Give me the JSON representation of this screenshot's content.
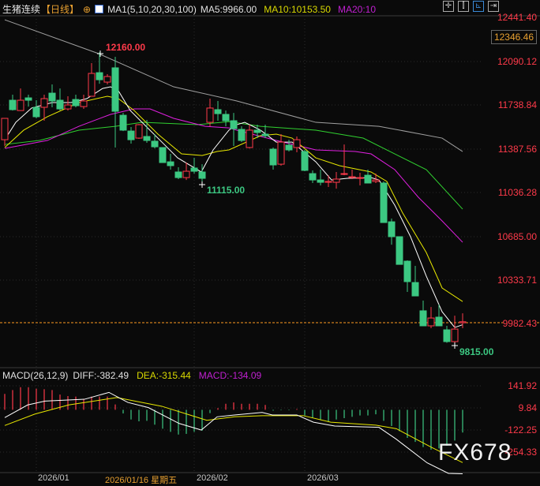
{
  "header": {
    "symbol": "生猪连续",
    "period": "【日线】",
    "indicator": "MA1(5,10,20,30,100)",
    "ma5": "MA5:9966.00",
    "ma10": "MA10:10153.50",
    "ma20": "MA20:10"
  },
  "macd_header": {
    "name": "MACD(26,12,9)",
    "diff": "DIFF:-382.49",
    "dea": "DEA:-315.44",
    "macd": "MACD:-134.09"
  },
  "price_axis": [
    "12441.40",
    "12090.12",
    "11738.84",
    "11387.56",
    "11036.28",
    "10685.00",
    "10333.71",
    "9982.43"
  ],
  "crosshair_price": "12346.46",
  "macd_axis": [
    "141.92",
    "9.84",
    "-122.25",
    "-254.33"
  ],
  "x_axis": {
    "jan": "2026/01",
    "cursor_date": "2026/01/16 星期五",
    "feb": "2026/02",
    "mar": "2026/03"
  },
  "annotations": {
    "high": "12160.00",
    "low1": "11115.00",
    "low2": "9815.00"
  },
  "watermark": "FX678",
  "colors": {
    "up": "#ff3a4a",
    "down": "#3cc882",
    "ma5": "#ffffff",
    "ma10": "#e8e800",
    "ma20": "#e020e0",
    "ma30": "#30d030",
    "ma100": "#a0a0a0",
    "current": "#ff9a20"
  },
  "chart_data": {
    "type": "candlestick",
    "current_price": 9982.43,
    "ylim": [
      9982.43,
      12441.4
    ],
    "candles_ohlc": [
      [
        11456,
        11628,
        11406,
        11628
      ],
      [
        11774,
        11819,
        11691,
        11698
      ],
      [
        11691,
        11869,
        11691,
        11774
      ],
      [
        11793,
        11819,
        11723,
        11774
      ],
      [
        11717,
        11774,
        11628,
        11641
      ],
      [
        11717,
        11819,
        11609,
        11787
      ],
      [
        11831,
        11901,
        11717,
        11768
      ],
      [
        11774,
        11869,
        11691,
        11704
      ],
      [
        11704,
        11806,
        11691,
        11736
      ],
      [
        11780,
        11819,
        11717,
        11730
      ],
      [
        11723,
        11819,
        11704,
        11768
      ],
      [
        11806,
        12073,
        11806,
        11990
      ],
      [
        11996,
        12160,
        11907,
        11939
      ],
      [
        11920,
        11984,
        11901,
        11965
      ],
      [
        12035,
        12124,
        11393,
        11685
      ],
      [
        11653,
        11672,
        11526,
        11533
      ],
      [
        11526,
        11558,
        11425,
        11456
      ],
      [
        11469,
        11583,
        11463,
        11577
      ],
      [
        11482,
        11615,
        11431,
        11450
      ],
      [
        11444,
        11501,
        11386,
        11399
      ],
      [
        11393,
        11393,
        11272,
        11272
      ],
      [
        11278,
        11342,
        11215,
        11247
      ],
      [
        11196,
        11234,
        11139,
        11151
      ],
      [
        11151,
        11272,
        11132,
        11202
      ],
      [
        11228,
        11310,
        11183,
        11202
      ],
      [
        11196,
        11259,
        11115,
        11145
      ],
      [
        11596,
        11787,
        11564,
        11711
      ],
      [
        11698,
        11768,
        11609,
        11666
      ],
      [
        11660,
        11691,
        11564,
        11609
      ],
      [
        11609,
        11672,
        11406,
        11545
      ],
      [
        11539,
        11564,
        11437,
        11450
      ],
      [
        11393,
        11577,
        11386,
        11533
      ],
      [
        11533,
        11577,
        11469,
        11514
      ],
      [
        11501,
        11577,
        11469,
        11488
      ],
      [
        11380,
        11393,
        11215,
        11253
      ],
      [
        11259,
        11501,
        11247,
        11437
      ],
      [
        11412,
        11456,
        11361,
        11374
      ],
      [
        11393,
        11482,
        11355,
        11456
      ],
      [
        11361,
        11374,
        11202,
        11209
      ],
      [
        11183,
        11209,
        11107,
        11132
      ],
      [
        11132,
        11215,
        11088,
        11113
      ],
      [
        11113,
        11170,
        11075,
        11120
      ],
      [
        11113,
        11196,
        11062,
        11139
      ],
      [
        11177,
        11418,
        11170,
        11183
      ],
      [
        11151,
        11215,
        11139,
        11158
      ],
      [
        11145,
        11190,
        11088,
        11151
      ],
      [
        11170,
        11215,
        11107,
        11107
      ],
      [
        11120,
        11183,
        11107,
        11132
      ],
      [
        11107,
        11120,
        10789,
        10789
      ],
      [
        10795,
        10821,
        10611,
        10675
      ],
      [
        10675,
        10675,
        10452,
        10452
      ],
      [
        10478,
        10484,
        10230,
        10313
      ],
      [
        10306,
        10440,
        10198,
        10198
      ],
      [
        10078,
        10160,
        9957,
        9957
      ],
      [
        9957,
        10109,
        9938,
        10020
      ],
      [
        10027,
        10128,
        9957,
        9957
      ],
      [
        9925,
        9957,
        9820,
        9830
      ],
      [
        9830,
        10039,
        9815,
        9931
      ],
      [
        9982,
        10058,
        9938,
        9990
      ]
    ],
    "ma_lines": {
      "ma5": [
        [
          0,
          11456
        ],
        [
          1.4,
          11596
        ],
        [
          3.4,
          11711
        ],
        [
          6,
          11755
        ],
        [
          8.4,
          11755
        ],
        [
          10.4,
          11787
        ],
        [
          12.4,
          11869
        ],
        [
          13.4,
          11882
        ],
        [
          14.4,
          11850
        ],
        [
          15.9,
          11691
        ],
        [
          17.9,
          11564
        ],
        [
          19.9,
          11437
        ],
        [
          21.9,
          11310
        ],
        [
          24.9,
          11196
        ],
        [
          26.4,
          11374
        ],
        [
          28.4,
          11533
        ],
        [
          29.4,
          11577
        ],
        [
          30.4,
          11596
        ],
        [
          32.4,
          11533
        ],
        [
          34.4,
          11437
        ],
        [
          36.4,
          11437
        ],
        [
          39.4,
          11278
        ],
        [
          41.4,
          11132
        ],
        [
          43.4,
          11145
        ],
        [
          46.4,
          11151
        ],
        [
          47.4,
          11132
        ],
        [
          49.4,
          10929
        ],
        [
          51.4,
          10675
        ],
        [
          53.4,
          10357
        ],
        [
          55.4,
          10071
        ],
        [
          57,
          9944
        ],
        [
          58,
          9966
        ]
      ],
      "ma10": [
        [
          0,
          11393
        ],
        [
          2.4,
          11533
        ],
        [
          5.4,
          11641
        ],
        [
          9.4,
          11755
        ],
        [
          13,
          11806
        ],
        [
          14.4,
          11787
        ],
        [
          16.4,
          11691
        ],
        [
          19.4,
          11501
        ],
        [
          22.4,
          11342
        ],
        [
          25,
          11329
        ],
        [
          26.9,
          11361
        ],
        [
          28.4,
          11374
        ],
        [
          32.4,
          11488
        ],
        [
          34.4,
          11501
        ],
        [
          36.4,
          11469
        ],
        [
          39.4,
          11310
        ],
        [
          42.4,
          11247
        ],
        [
          46.4,
          11196
        ],
        [
          48.4,
          11120
        ],
        [
          50.4,
          10866
        ],
        [
          53.4,
          10547
        ],
        [
          55.4,
          10262
        ],
        [
          58,
          10153
        ]
      ],
      "ma20": [
        [
          0,
          11386
        ],
        [
          5.4,
          11450
        ],
        [
          9.4,
          11564
        ],
        [
          13.4,
          11660
        ],
        [
          16.4,
          11704
        ],
        [
          18.4,
          11704
        ],
        [
          21.4,
          11628
        ],
        [
          25.4,
          11564
        ],
        [
          28.4,
          11551
        ],
        [
          29.4,
          11533
        ],
        [
          34.4,
          11450
        ],
        [
          39.4,
          11374
        ],
        [
          44.4,
          11361
        ],
        [
          46.4,
          11342
        ],
        [
          49.4,
          11215
        ],
        [
          52.4,
          10992
        ],
        [
          55.4,
          10802
        ],
        [
          58,
          10630
        ]
      ],
      "ma30": [
        [
          0,
          11418
        ],
        [
          4.4,
          11450
        ],
        [
          9.4,
          11533
        ],
        [
          14,
          11564
        ],
        [
          17.4,
          11596
        ],
        [
          24.4,
          11577
        ],
        [
          28.4,
          11602
        ],
        [
          32.4,
          11564
        ],
        [
          39.4,
          11533
        ],
        [
          45.4,
          11469
        ],
        [
          49.4,
          11342
        ],
        [
          53.4,
          11215
        ],
        [
          58,
          10897
        ]
      ],
      "ma100": [
        [
          0,
          12422
        ],
        [
          11.9,
          12149
        ],
        [
          21.4,
          11882
        ],
        [
          29.4,
          11768
        ],
        [
          39.4,
          11596
        ],
        [
          47.4,
          11564
        ],
        [
          55.4,
          11469
        ],
        [
          58,
          11361
        ]
      ]
    },
    "macd_hist": [
      95,
      118,
      135,
      135,
      126,
      123,
      118,
      91,
      82,
      79,
      63,
      79,
      79,
      79,
      32,
      -22,
      -58,
      -69,
      -66,
      -89,
      -113,
      -132,
      -148,
      -144,
      -132,
      -125,
      -20,
      10,
      36,
      44,
      36,
      36,
      36,
      29,
      -5,
      -3,
      -3,
      5,
      -34,
      -50,
      -62,
      -69,
      -58,
      -50,
      -42,
      -34,
      -34,
      -27,
      -66,
      -97,
      -128,
      -168,
      -192,
      -223,
      -239,
      -231,
      -215,
      -184,
      -136
    ],
    "macd_diff": [
      [
        0,
        -47
      ],
      [
        2.9,
        29
      ],
      [
        5.1,
        52
      ],
      [
        10.1,
        63
      ],
      [
        13.2,
        104
      ],
      [
        15.6,
        44
      ],
      [
        18.2,
        13
      ],
      [
        22.1,
        -82
      ],
      [
        24.9,
        -121
      ],
      [
        26.9,
        -42
      ],
      [
        29.1,
        -31
      ],
      [
        32.6,
        -16
      ],
      [
        33.9,
        -31
      ],
      [
        37,
        -31
      ],
      [
        39.1,
        -74
      ],
      [
        41.8,
        -97
      ],
      [
        47.4,
        -105
      ],
      [
        49.6,
        -176
      ],
      [
        53.5,
        -317
      ],
      [
        56.2,
        -380
      ],
      [
        58,
        -382.49
      ]
    ],
    "macd_dea": [
      [
        0,
        -94
      ],
      [
        3.8,
        -26
      ],
      [
        8.1,
        29
      ],
      [
        14.2,
        73
      ],
      [
        19.9,
        21
      ],
      [
        25.6,
        -63
      ],
      [
        29.1,
        -42
      ],
      [
        32.6,
        -35
      ],
      [
        37.8,
        -35
      ],
      [
        41.3,
        -74
      ],
      [
        47,
        -92
      ],
      [
        49.6,
        -113
      ],
      [
        54,
        -223
      ],
      [
        58,
        -315.44
      ]
    ]
  }
}
